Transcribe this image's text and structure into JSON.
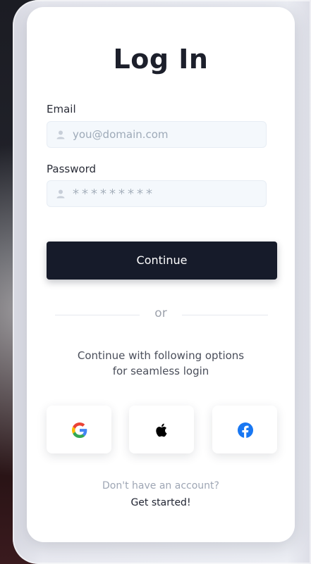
{
  "login": {
    "title": "Log In",
    "email_label": "Email",
    "email_placeholder": "you@domain.com",
    "password_label": "Password",
    "password_masked": "*********",
    "continue_label": "Continue",
    "divider_text": "or",
    "options_text_line1": "Continue with following options",
    "options_text_line2": "for seamless login",
    "social_buttons": [
      "google-icon",
      "apple-icon",
      "facebook-icon"
    ],
    "no_account_text": "Don't have an account?",
    "get_started_label": "Get started!"
  },
  "colors": {
    "button_bg": "#161b2a",
    "field_bg": "#f4f8fc",
    "facebook": "#1877f2"
  }
}
